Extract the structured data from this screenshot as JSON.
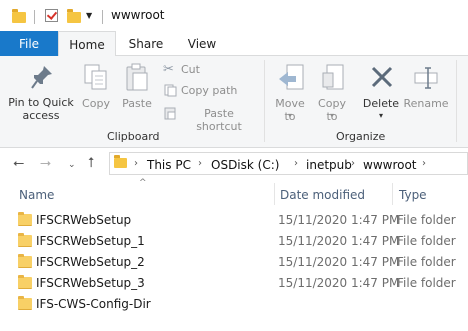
{
  "window": {
    "title": "wwwroot"
  },
  "tabs": {
    "file": "File",
    "home": "Home",
    "share": "Share",
    "view": "View"
  },
  "ribbon": {
    "pin_label": "Pin to Quick access",
    "copy_label": "Copy",
    "paste_label": "Paste",
    "cut_label": "Cut",
    "copy_path_label": "Copy path",
    "paste_shortcut_label": "Paste shortcut",
    "clipboard_group": "Clipboard",
    "move_to_label": "Move to",
    "copy_to_label": "Copy to",
    "delete_label": "Delete",
    "rename_label": "Rename",
    "organize_group": "Organize"
  },
  "address": {
    "crumbs": [
      "This PC",
      "OSDisk (C:)",
      "inetpub",
      "wwwroot"
    ]
  },
  "columns": {
    "name": "Name",
    "date": "Date modified",
    "type": "Type"
  },
  "files": [
    {
      "name": "IFSCRWebSetup",
      "date": "15/11/2020 1:47 PM",
      "type": "File folder"
    },
    {
      "name": "IFSCRWebSetup_1",
      "date": "15/11/2020 1:47 PM",
      "type": "File folder"
    },
    {
      "name": "IFSCRWebSetup_2",
      "date": "15/11/2020 1:47 PM",
      "type": "File folder"
    },
    {
      "name": "IFSCRWebSetup_3",
      "date": "15/11/2020 1:47 PM",
      "type": "File folder"
    },
    {
      "name": "IFS-CWS-Config-Dir",
      "date": "",
      "type": ""
    }
  ]
}
